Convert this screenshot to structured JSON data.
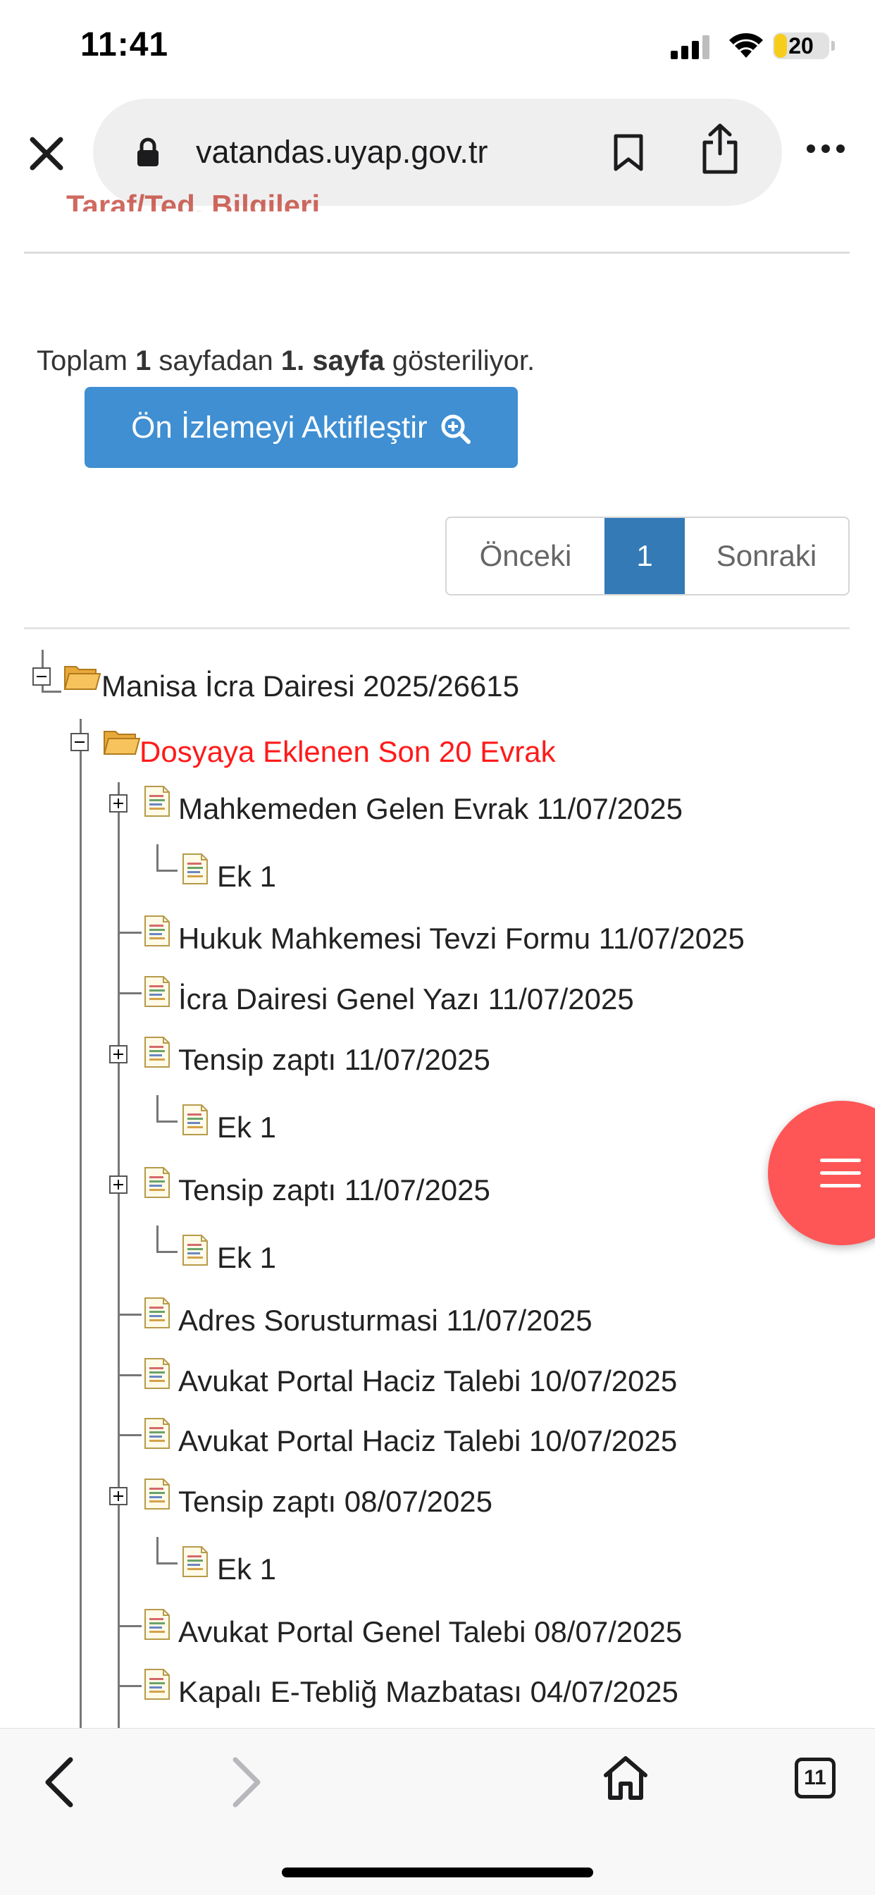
{
  "status_bar": {
    "time": "11:41",
    "battery": "20"
  },
  "browser": {
    "url": "vatandas.uyap.gov.tr",
    "icons": [
      "close-icon",
      "lock-icon",
      "bookmark-icon",
      "share-icon",
      "more-icon"
    ]
  },
  "cut_heading": "Taraf/Ted. Bilgileri",
  "page_info": {
    "prefix": "Toplam ",
    "total": "1",
    "middle": " sayfadan ",
    "current": "1. sayfa",
    "suffix": " gösteriliyor."
  },
  "preview_button": "Ön İzlemeyi Aktifleştir",
  "pagination": {
    "prev": "Önceki",
    "page": "1",
    "next": "Sonraki"
  },
  "tree": {
    "root": "Manisa İcra Dairesi 2025/26615",
    "group": "Dosyaya Eklenen Son 20 Evrak",
    "items": [
      "Mahkemeden Gelen Evrak 11/07/2025",
      "Ek 1",
      "Hukuk Mahkemesi Tevzi Formu 11/07/2025",
      "İcra Dairesi Genel Yazı 11/07/2025",
      "Tensip zaptı 11/07/2025",
      "Ek 1",
      "Tensip zaptı 11/07/2025",
      "Ek 1",
      "Adres Sorusturmasi 11/07/2025",
      "Avukat Portal Haciz Talebi 10/07/2025",
      "Avukat Portal Haciz Talebi 10/07/2025",
      "Tensip zaptı 08/07/2025",
      "Ek 1",
      "Avukat Portal Genel Talebi 08/07/2025",
      "Kapalı E-Tebliğ Mazbatası 04/07/2025"
    ]
  },
  "fab": {
    "icon": "menu-icon",
    "color": "#fe5656"
  },
  "toolbar": {
    "tabs_count": "11",
    "icons": [
      "back-icon",
      "forward-icon",
      "home-icon",
      "tabs-icon"
    ]
  },
  "colors": {
    "accent_blue": "#3f8fd2",
    "active_page": "#337ab7",
    "red_label": "#ff1a1a"
  }
}
